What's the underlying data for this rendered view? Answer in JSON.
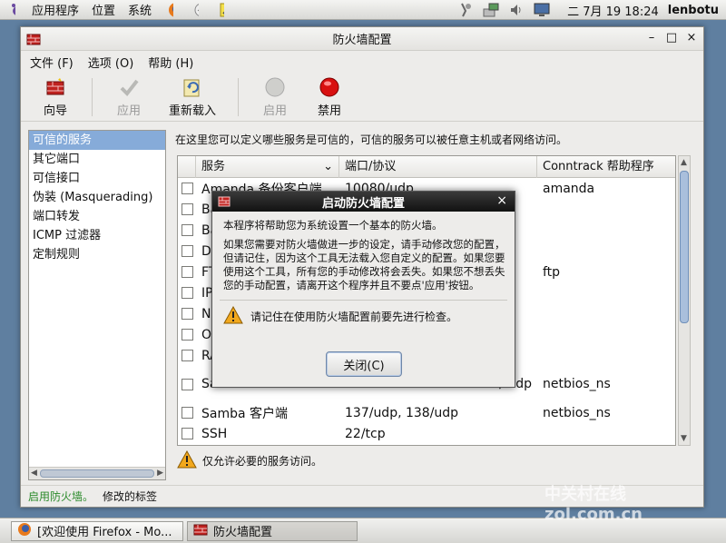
{
  "top_panel": {
    "menus": [
      "应用程序",
      "位置",
      "系统"
    ],
    "launchers": [
      "firefox-icon",
      "mail-icon",
      "notes-icon"
    ],
    "clock": "二  7月 19 18:24",
    "user": "lenbotu"
  },
  "window": {
    "title": "防火墙配置",
    "menu": [
      "文件 (F)",
      "选项 (O)",
      "帮助 (H)"
    ],
    "toolbar": [
      {
        "label": "向导",
        "icon": "wizard-icon",
        "enabled": true
      },
      {
        "label": "应用",
        "icon": "apply-check-icon",
        "enabled": false
      },
      {
        "label": "重新载入",
        "icon": "reload-icon",
        "enabled": true
      },
      {
        "label": "启用",
        "icon": "enable-icon",
        "enabled": false
      },
      {
        "label": "禁用",
        "icon": "disable-icon",
        "enabled": true
      }
    ],
    "sidebar": [
      {
        "label": "可信的服务",
        "selected": true
      },
      {
        "label": "其它端口"
      },
      {
        "label": "可信接口"
      },
      {
        "label": "伪装 (Masquerading)"
      },
      {
        "label": "端口转发"
      },
      {
        "label": "ICMP 过滤器"
      },
      {
        "label": "定制规则"
      }
    ],
    "description": "在这里您可以定义哪些服务是可信的，可信的服务可以被任意主机或者网络访问。",
    "table": {
      "headers": [
        "服务",
        "端口/协议",
        "Conntrack 帮助程序"
      ],
      "rows": [
        {
          "service": "Amanda 备份客户端",
          "port": "10080/udp",
          "helper": "amanda"
        },
        {
          "service": "Ba",
          "port": "",
          "helper": ""
        },
        {
          "service": "Ba",
          "port": "",
          "helper": ""
        },
        {
          "service": "DN",
          "port": "",
          "helper": ""
        },
        {
          "service": "FT",
          "port": "",
          "helper": "ftp"
        },
        {
          "service": "IP",
          "port": "",
          "helper": ""
        },
        {
          "service": "NF",
          "port": "",
          "helper": ""
        },
        {
          "service": "Op",
          "port": "",
          "helper": ""
        },
        {
          "service": "RA",
          "port": "",
          "helper": ""
        },
        {
          "service": "Sa",
          "port": "8/ udp",
          "helper": "netbios_ns"
        },
        {
          "service": "Samba 客户端",
          "port": "137/udp, 138/udp",
          "helper": "netbios_ns"
        },
        {
          "service": "SSH",
          "port": "22/tcp",
          "helper": ""
        }
      ]
    },
    "bottom_warning": "仅允许必要的服务访问。",
    "status": {
      "enabled": "启用防火墙。",
      "modified": "修改的标签"
    }
  },
  "dialog": {
    "title": "启动防火墙配置",
    "close_glyph": "×",
    "para1": "本程序将帮助您为系统设置一个基本的防火墙。",
    "para2": "如果您需要对防火墙做进一步的设定，请手动修改您的配置，但请记住，因为这个工具无法载入您自定义的配置。如果您要使用这个工具，所有您的手动修改将会丢失。如果您不想丢失您的手动配置，请离开这个程序并且不要点'应用'按钮。",
    "warning": "请记住在使用防火墙配置前要先进行检查。",
    "button": "关闭(C)"
  },
  "taskbar": {
    "tasks": [
      {
        "label": "[欢迎使用 Firefox - Mo...",
        "icon": "firefox-icon"
      },
      {
        "label": "防火墙配置",
        "icon": "firewall-icon"
      }
    ]
  },
  "watermark": "中关村在线 zol.com.cn"
}
